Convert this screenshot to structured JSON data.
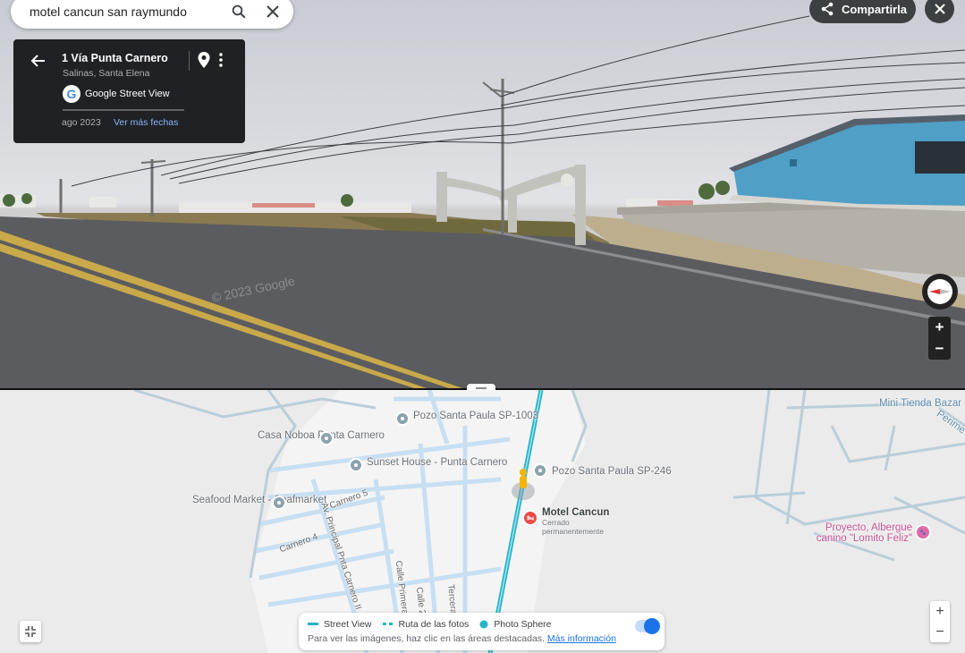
{
  "search": {
    "query": "motel cancun san raymundo"
  },
  "location_card": {
    "title": "1 Vía Punta Carnero",
    "subtitle": "Salinas, Santa Elena",
    "brand": "Google Street View",
    "date": "ago 2023",
    "more_dates_link": "Ver más fechas"
  },
  "toolbar": {
    "share_label": "Compartirla"
  },
  "panorama": {
    "watermark": "© 2023 Google"
  },
  "streetview_zoom": {
    "in": "+",
    "out": "−"
  },
  "map": {
    "labels": {
      "pozo_1003": "Pozo Santa Paula SP-1003",
      "casa_noboa": "Casa Noboa Punta Carnero",
      "sunset_house": "Sunset House - Punta Carnero",
      "pozo_246": "Pozo Santa Paula SP-246",
      "seafood_market": "Seafood Market - Seafmarket",
      "motel_name": "Motel Cancun",
      "motel_status": "Cerrado permanentemente",
      "mini_tienda": "Mini Tienda Bazar",
      "perimetral": "Perime",
      "proyecto": "Proyecto, Albergue canino \"Lomito Feliz\"",
      "carnero5": "Carnero 5",
      "carnero4": "Carnero 4",
      "av_principal": "Av. Principal Pnta Carnero II",
      "calle_primera": "Calle Primera",
      "calle2": "Calle 2",
      "tercera": "Tercera"
    },
    "legend": {
      "street_view": "Street View",
      "photo_route": "Ruta de las fotos",
      "photo_sphere": "Photo Sphere",
      "hint": "Para ver las imágenes, haz clic en las áreas destacadas.",
      "more_info": "Más información"
    },
    "zoom": {
      "in": "+",
      "out": "−"
    }
  },
  "colors": {
    "street_view_line": "#26b3c9",
    "accent_blue": "#1a73e8",
    "motel_pin": "#e94b4b"
  },
  "icons": [
    "search-icon",
    "close-icon",
    "back-arrow-icon",
    "location-pin-icon",
    "more-vert-icon",
    "google-logo-icon",
    "share-icon",
    "compass-icon",
    "pegman-icon",
    "collapse-icon"
  ]
}
